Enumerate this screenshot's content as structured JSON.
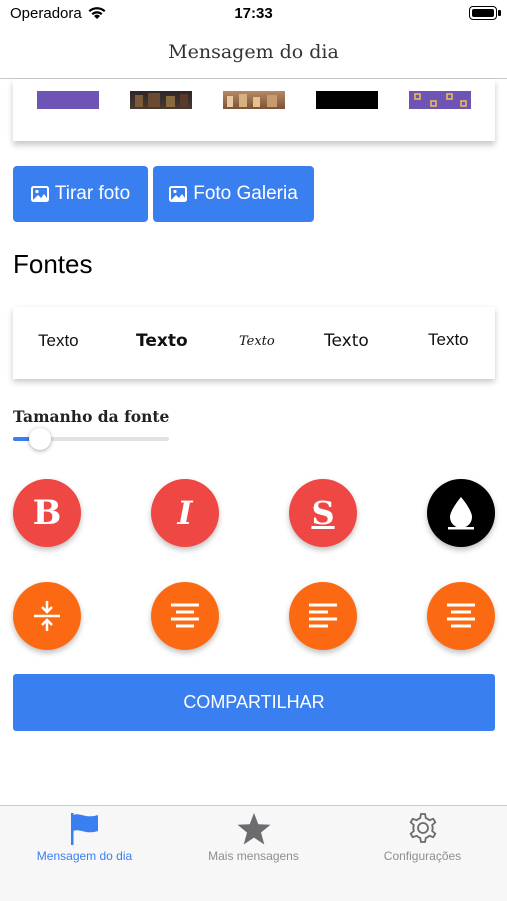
{
  "status_bar": {
    "carrier": "Operadora",
    "time": "17:33"
  },
  "navbar": {
    "title": "Mensagem do dia"
  },
  "background_images": {
    "thumbnails": [
      {
        "name": "purple",
        "color": "#6d54b5"
      },
      {
        "name": "building-night",
        "color": "#3a3032"
      },
      {
        "name": "building-day",
        "color": "#9a6a45"
      },
      {
        "name": "black",
        "color": "#000000"
      },
      {
        "name": "pattern",
        "color": "#6d54b5"
      }
    ]
  },
  "photo_buttons": {
    "take_photo": "Tirar foto",
    "gallery": "Foto Galeria"
  },
  "fonts_section": {
    "title": "Fontes",
    "options": [
      "Texto",
      "Texto",
      "Texto",
      "Texto",
      "Texto"
    ]
  },
  "font_size": {
    "label": "Tamanho da fonte",
    "value": 0.17
  },
  "format_buttons": {
    "bold": "B",
    "italic": "I",
    "strike": "S"
  },
  "share_button": "COMPARTILHAR",
  "tabs": [
    {
      "label": "Mensagem do dia",
      "icon": "flag-icon",
      "active": true
    },
    {
      "label": "Mais mensagens",
      "icon": "star-icon",
      "active": false
    },
    {
      "label": "Configurações",
      "icon": "gear-icon",
      "active": false
    }
  ],
  "colors": {
    "accent": "#3a7ff0",
    "red": "#ee4744",
    "orange": "#fb6a12"
  }
}
